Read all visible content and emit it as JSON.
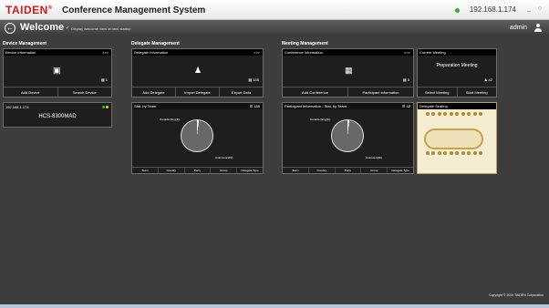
{
  "header": {
    "brand": "TAIDEN",
    "registered": "®",
    "system": "Conference Management System",
    "ip": "192.168.1.174",
    "minimize": "_",
    "close": "○"
  },
  "welcome": {
    "back": "←",
    "title": "Welcome",
    "startup": "Display welcome view at next startup",
    "check": "✓",
    "user": "admin"
  },
  "sections": {
    "device": "Device Management",
    "delegate": "Delegate Management",
    "meeting": "Meeting Management"
  },
  "device_info": {
    "title": "Device Information",
    "more": ">>>",
    "icon": "▣",
    "count": "▦ 1",
    "actions": [
      "Add Device",
      "Search Device"
    ]
  },
  "device_status": {
    "ip": "192.168.1.174",
    "model": "HCS-8300MAD"
  },
  "delegate_info": {
    "title": "Delegate Information",
    "more": ">>>",
    "icon": "♟",
    "count": "▦ 185",
    "actions": [
      "Add Delegate",
      "Import Delegate",
      "Export Data"
    ]
  },
  "stat_team": {
    "title": "Stat. by Team",
    "count": "☰ 185",
    "labels": {
      "a": "Canada (Eng(3))",
      "b": "Unknown(182)"
    },
    "tabs": [
      "Team",
      "Country",
      "Party",
      "Group",
      "Delegate Type"
    ]
  },
  "conference_info": {
    "title": "Conference Information",
    "more": ">>>",
    "icon": "▦",
    "count": "▦ 3",
    "actions": [
      "Add Conference",
      "Participant Information"
    ]
  },
  "participant_stat": {
    "title": "Participant Information - Stat. by Team",
    "count": "☰ 42",
    "labels": {
      "a": "Canada (Eng(3))",
      "b": "Unknown(39)"
    },
    "tabs": [
      "Team",
      "Country",
      "Party",
      "Group",
      "Delegate Type"
    ]
  },
  "current_meeting": {
    "title": "Current Meeting",
    "status": "Preparation Meeting",
    "count": "♟ 42",
    "actions": [
      "Select Meeting",
      "Start Meeting"
    ]
  },
  "delegate_seating": {
    "title": "Delegate Seating"
  },
  "footer": {
    "copyright": "Copyright © 2019 TAIDEN Corporation"
  }
}
